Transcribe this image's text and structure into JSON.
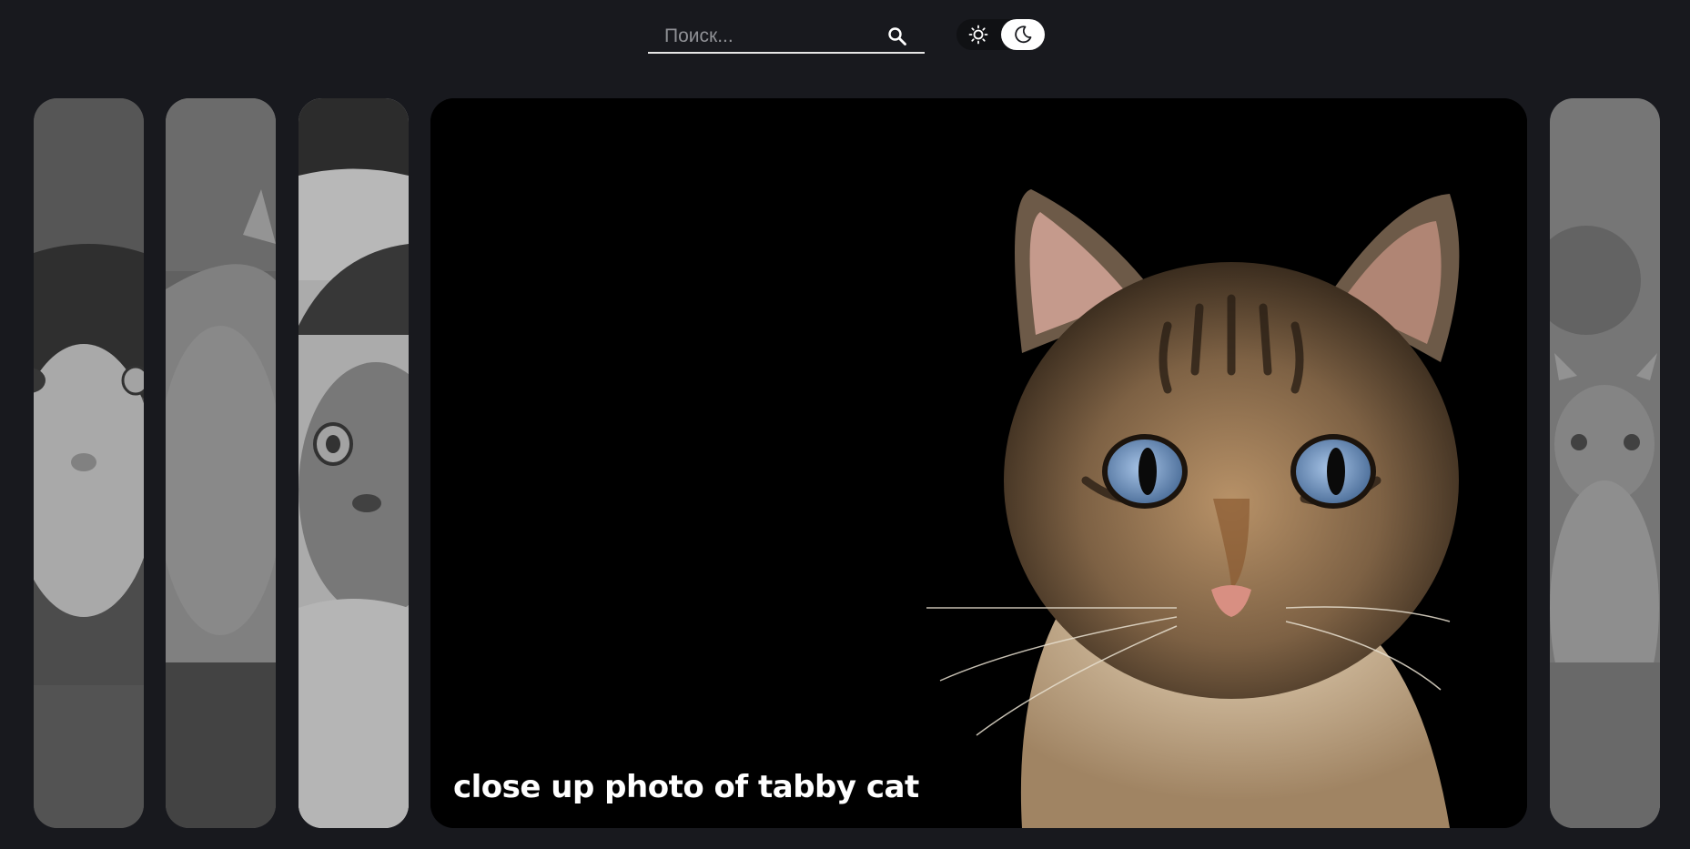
{
  "search": {
    "placeholder": "Поиск...",
    "value": ""
  },
  "icons": {
    "search": "search-icon",
    "light_theme": "sun-icon",
    "dark_theme": "moon-icon"
  },
  "theme": {
    "selected": "dark"
  },
  "gallery": {
    "active_caption": "close up photo of tabby cat",
    "cards": [
      {
        "state": "collapsed",
        "subject": "cat"
      },
      {
        "state": "collapsed",
        "subject": "cat"
      },
      {
        "state": "collapsed",
        "subject": "cat"
      },
      {
        "state": "expanded",
        "subject": "tabby cat"
      },
      {
        "state": "collapsed",
        "subject": "kitten"
      }
    ]
  },
  "colors": {
    "background": "#18191e",
    "toggle_bg": "#101114",
    "caption": "#ffffff"
  }
}
